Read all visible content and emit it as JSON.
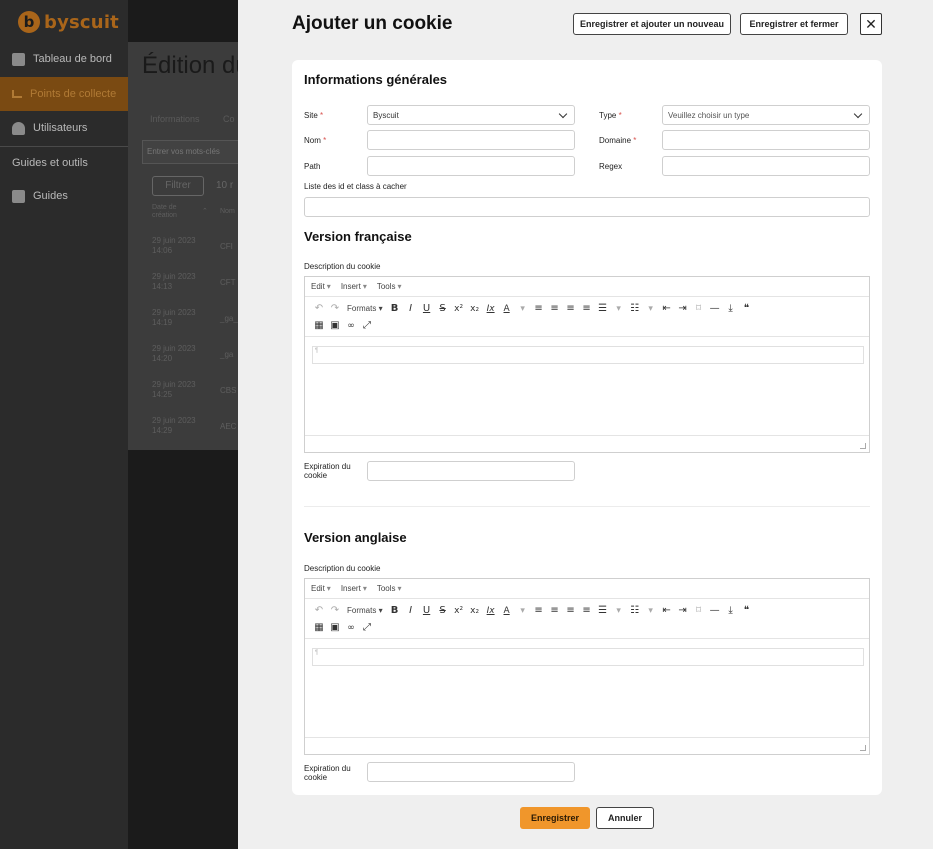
{
  "background": {
    "logo_badge": "b",
    "logo_text": "byscuit",
    "nav": [
      {
        "label": "Tableau de bord",
        "icon": "dashboard-icon"
      },
      {
        "label": "Points de collecte",
        "icon": "collect-icon"
      },
      {
        "label": "Utilisateurs",
        "icon": "user-icon"
      }
    ],
    "section": "Guides et outils",
    "guides": "Guides",
    "page_title": "Édition du",
    "tabs": [
      "Informations",
      "Co"
    ],
    "search_placeholder": "Entrer vos mots-clés",
    "filter_label": "Filtrer",
    "count": "10 r",
    "table_header": [
      "Date de",
      "création",
      "Nom"
    ],
    "rows": [
      {
        "date": "29 juin 2023",
        "time": "14:06",
        "code": "CFI"
      },
      {
        "date": "29 juin 2023",
        "time": "14:13",
        "code": "CFT"
      },
      {
        "date": "29 juin 2023",
        "time": "14:19",
        "code": "_ga_"
      },
      {
        "date": "29 juin 2023",
        "time": "14:20",
        "code": "_ga"
      },
      {
        "date": "29 juin 2023",
        "time": "14:25",
        "code": "CBS"
      },
      {
        "date": "29 juin 2023",
        "time": "14:29",
        "code": "AEC"
      }
    ]
  },
  "drawer": {
    "title": "Ajouter un cookie",
    "save_add_label": "Enregistrer et ajouter un nouveau",
    "save_close_label": "Enregistrer et fermer",
    "close_symbol": "✕"
  },
  "general": {
    "title": "Informations générales",
    "site_label": "Site",
    "site_value": "Byscuit",
    "type_label": "Type",
    "type_placeholder": "Veuillez choisir un type",
    "nom_label": "Nom",
    "domaine_label": "Domaine",
    "path_label": "Path",
    "regex_label": "Regex",
    "hide_label": "Liste des id et class à cacher",
    "required_mark": "*"
  },
  "fr": {
    "title": "Version française",
    "desc_label": "Description du cookie",
    "exp_label_1": "Expiration du",
    "exp_label_2": "cookie"
  },
  "en": {
    "title": "Version anglaise",
    "desc_label": "Description du cookie",
    "exp_label_1": "Expiration du",
    "exp_label_2": "cookie"
  },
  "editor": {
    "menu": [
      "Edit",
      "Insert",
      "Tools"
    ],
    "formats_label": "Formats",
    "tools": {
      "undo": "↶",
      "redo": "↷",
      "bold": "B",
      "italic": "I",
      "underline": "U",
      "strike": "S",
      "sup": "x²",
      "sub": "x₂",
      "clear": "Ix",
      "color": "A",
      "align_left": "≡",
      "align_center": "≡",
      "align_right": "≡",
      "justify": "≡",
      "bullets": "☰",
      "numbers": "☷",
      "outdent": "⇤",
      "indent": "⇥",
      "bookmark": "⌑",
      "hr": "—",
      "download": "⤓",
      "quote": "❝",
      "table": "▦",
      "image": "▣",
      "link": "🔗",
      "fullscreen": "⤢"
    }
  },
  "footer": {
    "save_label": "Enregistrer",
    "cancel_label": "Annuler"
  },
  "colors": {
    "accent": "#f0962b",
    "required": "#d9534f"
  }
}
